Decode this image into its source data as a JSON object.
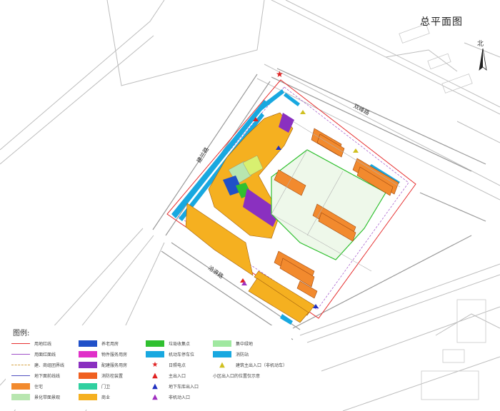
{
  "title": "总平面图",
  "north": "北",
  "roads": {
    "north_road": "双峰路",
    "west_road": "建兰路",
    "south_road": "沧浪路"
  },
  "legend": {
    "title": "图例:",
    "columns": [
      [
        {
          "kind": "line",
          "color": "#e63030",
          "label": "用地红线"
        },
        {
          "kind": "line",
          "color": "#a050c8",
          "label": "用面红面线"
        },
        {
          "kind": "dashed",
          "color": "#d4a040",
          "label": "建、商组团界线"
        },
        {
          "kind": "line",
          "color": "#5050c0",
          "label": "地下面前线线"
        },
        {
          "kind": "fill",
          "color": "#f28a2e",
          "label": "住宅"
        },
        {
          "kind": "fill",
          "color": "#b8e6b0",
          "label": "景化带面景观"
        }
      ],
      [
        {
          "kind": "fill",
          "color": "#2050c8",
          "label": "养老用房"
        },
        {
          "kind": "fill",
          "color": "#e030c8",
          "label": "物件服务用房"
        },
        {
          "kind": "fill",
          "color": "#8a30c0",
          "label": "配建服务用房"
        },
        {
          "kind": "fill",
          "color": "#f06020",
          "label": "消防栓装置"
        },
        {
          "kind": "fill",
          "color": "#30d0a0",
          "label": "门卫"
        },
        {
          "kind": "fill",
          "color": "#f5b020",
          "label": "商业"
        }
      ],
      [
        {
          "kind": "fill",
          "color": "#30c030",
          "label": "垃圾收集点"
        },
        {
          "kind": "fill",
          "color": "#18a8e0",
          "label": "机动车停车位"
        },
        {
          "kind": "icon",
          "color": "#e02020",
          "glyph": "★",
          "label": "日照电点"
        },
        {
          "kind": "icon",
          "color": "#e02020",
          "glyph": "▲",
          "label": "主出入口"
        },
        {
          "kind": "icon",
          "color": "#2030c0",
          "glyph": "▲",
          "label": "地下车库出入口"
        },
        {
          "kind": "icon",
          "color": "#a030c0",
          "glyph": "▲",
          "label": "非机动入口"
        }
      ]
    ],
    "extra": [
      {
        "kind": "fill",
        "color": "#a0e8a0",
        "label": "集中绿地"
      },
      {
        "kind": "fill",
        "color": "#18a8e0",
        "label": "消防站"
      },
      {
        "kind": "icon",
        "color": "#d0c020",
        "glyph": "▲",
        "label": "建筑主出入口（非机动车）"
      },
      {
        "kind": "text",
        "label": "小区出入口的位置仅示意"
      }
    ]
  }
}
